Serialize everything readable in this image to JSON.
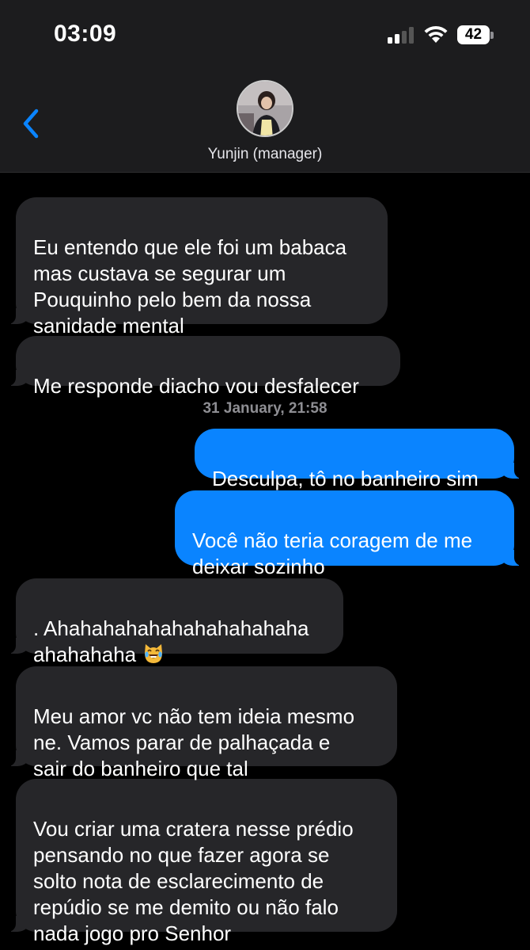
{
  "status_bar": {
    "time": "03:09",
    "battery": "42"
  },
  "header": {
    "back_icon": "chevron-left-icon",
    "contact_name": "Yunjin (manager)"
  },
  "timestamp": "31 January, 21:58",
  "messages": [
    {
      "direction": "incoming",
      "text": "Eu entendo que ele foi um babaca\nmas custava se segurar um\nPouquinho pelo bem da nossa\nsanidade mental"
    },
    {
      "direction": "incoming",
      "text": "Me responde diacho vou desfalecer"
    },
    {
      "direction": "outgoing",
      "text": "Desculpa, tô no banheiro sim"
    },
    {
      "direction": "outgoing",
      "text": "Você não teria coragem de me\ndeixar sozinho"
    },
    {
      "direction": "incoming",
      "text": ". Ahahahahahahahahahahaha\nahahahaha",
      "emoji": "crying-laughing-cat"
    },
    {
      "direction": "incoming",
      "text": "Meu amor vc não tem ideia mesmo\nne. Vamos parar de palhaçada e\nsair do banheiro que tal"
    },
    {
      "direction": "incoming",
      "text": "Vou criar uma cratera nesse prédio\npensando no que fazer agora se\nsolto nota de esclarecimento de\nrepúdio se me demito ou não falo\nnada jogo pro Senhor"
    }
  ],
  "colors": {
    "incoming_bubble": "#262629",
    "outgoing_bubble": "#0a84ff",
    "header_bg": "#1c1c1e"
  }
}
